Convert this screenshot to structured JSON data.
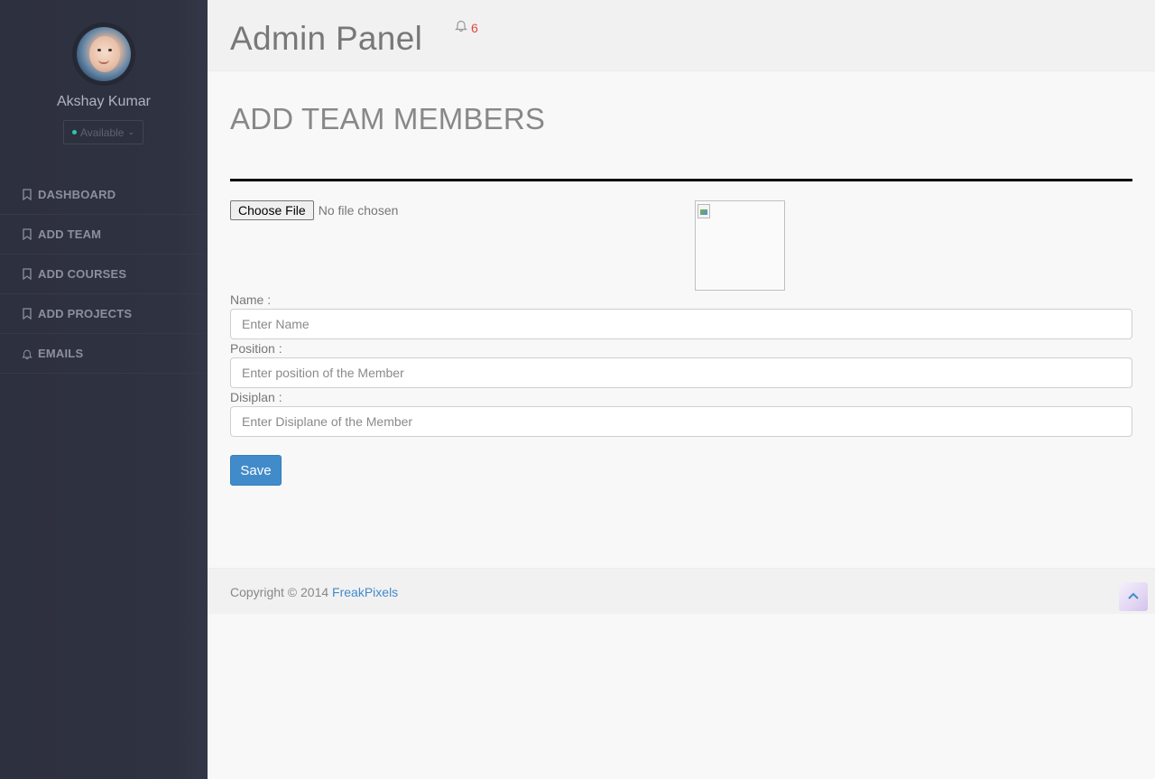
{
  "sidebar": {
    "user_name": "Akshay Kumar",
    "status": "Available",
    "items": [
      {
        "label": "DASHBOARD",
        "icon": "bookmark-icon"
      },
      {
        "label": "ADD TEAM",
        "icon": "bookmark-icon"
      },
      {
        "label": "ADD COURSES",
        "icon": "bookmark-icon"
      },
      {
        "label": "ADD PROJECTS",
        "icon": "bookmark-icon"
      },
      {
        "label": "EMAILS",
        "icon": "bell-icon"
      }
    ]
  },
  "header": {
    "title": "Admin Panel",
    "notification_count": "6"
  },
  "main": {
    "section_title": "ADD TEAM MEMBERS",
    "file_input": {
      "button_label": "Choose File",
      "status": "No file chosen"
    },
    "fields": {
      "name": {
        "label": "Name :",
        "placeholder": "Enter Name"
      },
      "position": {
        "label": "Position :",
        "placeholder": "Enter position of the Member"
      },
      "discipline": {
        "label": "Disiplan :",
        "placeholder": "Enter Disiplane of the Member"
      }
    },
    "save_label": "Save"
  },
  "footer": {
    "copyright_text": "Copyright © 2014",
    "link_text": "FreakPixels"
  },
  "colors": {
    "sidebar_bg": "#2d303e",
    "accent_blue": "#428bca",
    "notification_red": "#e8443b",
    "status_green": "#2ec3b5"
  }
}
